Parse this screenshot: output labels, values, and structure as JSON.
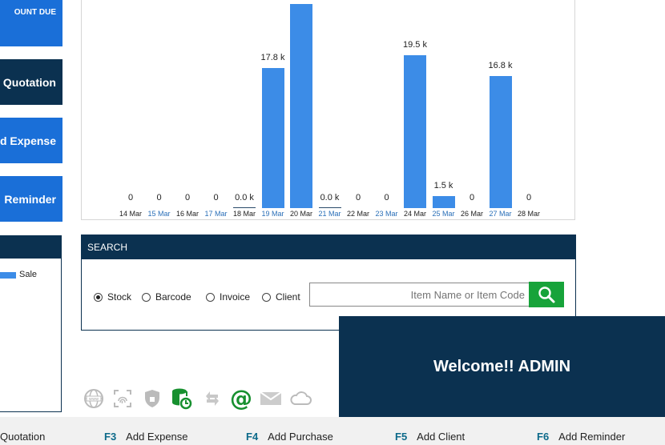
{
  "left_buttons": [
    {
      "label": "OUNT DUE"
    },
    {
      "label": "Quotation"
    },
    {
      "label": "ld Expense"
    },
    {
      "label": "Reminder"
    }
  ],
  "legend": {
    "label": "Sale",
    "color": "#3c8ce7"
  },
  "chart_data": {
    "type": "bar",
    "categories": [
      "14 Mar",
      "15 Mar",
      "16 Mar",
      "17 Mar",
      "18 Mar",
      "19 Mar",
      "20 Mar",
      "21 Mar",
      "22 Mar",
      "23 Mar",
      "24 Mar",
      "25 Mar",
      "26 Mar",
      "27 Mar",
      "28 Mar"
    ],
    "series": [
      {
        "name": "Sale",
        "values": [
          0,
          0,
          0,
          0,
          0,
          17800,
          26000,
          0,
          0,
          0,
          19500,
          1500,
          0,
          16800,
          0
        ],
        "labels": [
          "0",
          "0",
          "0",
          "0",
          "0.0 k",
          "17.8 k",
          "",
          "0.0 k",
          "0",
          "0",
          "19.5 k",
          "1.5 k",
          "0",
          "16.8 k",
          "0"
        ]
      }
    ],
    "ylim": [
      0,
      26000
    ],
    "label_colors": [
      "#222222",
      "#2a6fb8",
      "#222222",
      "#2a6fb8",
      "#222222",
      "#2a6fb8",
      "#222222",
      "#2a6fb8",
      "#222222",
      "#2a6fb8",
      "#222222",
      "#2a6fb8",
      "#222222",
      "#2a6fb8",
      "#222222"
    ]
  },
  "search": {
    "title": "SEARCH",
    "options": [
      "Stock",
      "Barcode",
      "Invoice",
      "Client"
    ],
    "selected": "Stock",
    "placeholder": "Item Name or Item Code"
  },
  "welcome": {
    "text": "Welcome!! ADMIN"
  },
  "toolbar_icons": [
    "globe-icon",
    "fingerprint-icon",
    "shield-icon",
    "database-sync-icon",
    "refresh-icon",
    "at-icon",
    "mail-icon",
    "cloud-icon"
  ],
  "shortcuts": [
    {
      "key": "",
      "label": "Quotation"
    },
    {
      "key": "F3",
      "label": "Add Expense"
    },
    {
      "key": "F4",
      "label": "Add Purchase"
    },
    {
      "key": "F5",
      "label": "Add Client"
    },
    {
      "key": "F6",
      "label": "Add Reminder"
    }
  ]
}
